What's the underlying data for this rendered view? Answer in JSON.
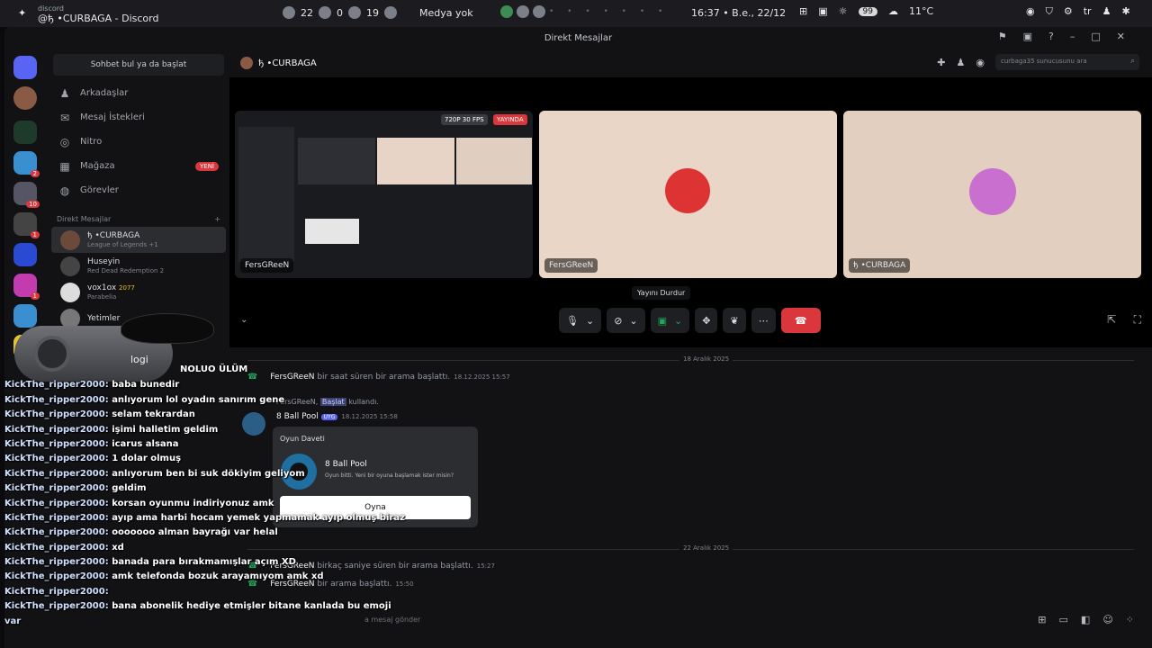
{
  "os": {
    "window_small": "discord",
    "window_title": "@ђ •CURBAGA - Discord",
    "stat_1": "22",
    "stat_2": "0",
    "stat_3": "19",
    "media": "Medya yok",
    "clock": "16:37 • B.e., 22/12",
    "badge": "99",
    "weather": "11°C",
    "lang": "tr"
  },
  "titlebar": {
    "title": "Direkt Mesajlar"
  },
  "guild_pings": [
    "2",
    "10",
    "1",
    "1"
  ],
  "dm_sidebar": {
    "find_label": "Sohbet bul ya da başlat",
    "nav": [
      {
        "label": "Arkadaşlar"
      },
      {
        "label": "Mesaj İstekleri"
      },
      {
        "label": "Nitro"
      },
      {
        "label": "Mağaza",
        "badge": "YENİ"
      },
      {
        "label": "Görevler"
      }
    ],
    "dm_header": "Direkt Mesajlar",
    "dms": [
      {
        "name": "ђ •CURBAGA",
        "sub": "League of Legends +1"
      },
      {
        "name": "Huseyin",
        "sub": "Red Dead Redemption 2"
      },
      {
        "name": "vox1ox",
        "tag": "2077",
        "sub": "Parabelia"
      },
      {
        "name": "Yetimler",
        "sub": ""
      }
    ]
  },
  "header": {
    "channel": "ђ •CURBAGA",
    "search_placeholder": "curbaga35 sunucusunu ara"
  },
  "call": {
    "tiles": [
      {
        "label": "FersGReeN",
        "badge_quality": "720P 30 FPS",
        "badge_live": "YAYINDA"
      },
      {
        "label": "FersGReeN"
      },
      {
        "label": "ђ •CURBAGA"
      }
    ],
    "tooltip": "Yayını Durdur"
  },
  "chat": {
    "date_1": "18 Aralık 2025",
    "call_1": {
      "user": "FersGReeN",
      "text": "bir saat süren bir arama başlattı.",
      "time": "18.12.2025 15:57"
    },
    "activity": {
      "user": "FersGReeN",
      "action": "Başlat",
      "suffix": "kullandı."
    },
    "bot": {
      "name": "8 Ball Pool",
      "tag": "UYG",
      "time": "18.12.2025 15:58"
    },
    "invite": {
      "title": "Oyun Daveti",
      "game": "8 Ball Pool",
      "desc": "Oyun bitti. Yeni bir oyuna başlamak ister misin?",
      "button": "Oyna"
    },
    "date_2": "22 Aralık 2025",
    "call_2": {
      "user": "FersGReeN",
      "text": "birkaç saniye süren bir arama başlattı.",
      "time": "15:27"
    },
    "call_3": {
      "user": "FersGReeN",
      "text": "bir arama başlattı.",
      "time": "15:50"
    },
    "input_placeholder": "a mesaj gönder"
  },
  "overlay": {
    "cam_logo": "logi",
    "noluo": "NOLUO ÜLÜM",
    "lines": [
      {
        "user": "",
        "text": ""
      },
      {
        "user": "KickThe_ripper2000:",
        "text": "baba bunedir"
      },
      {
        "user": "KickThe_ripper2000:",
        "text": "anlıyorum lol oyadın sanırım gene"
      },
      {
        "user": "KickThe_ripper2000:",
        "text": "selam tekrardan"
      },
      {
        "user": "KickThe_ripper2000:",
        "text": "işimi halletim geldim"
      },
      {
        "user": "KickThe_ripper2000:",
        "text": "icarus alsana"
      },
      {
        "user": "KickThe_ripper2000:",
        "text": "1 dolar olmuş"
      },
      {
        "user": "KickThe_ripper2000:",
        "text": "anlıyorum ben bi suk dökiyim geliyom"
      },
      {
        "user": "KickThe_ripper2000:",
        "text": "geldim"
      },
      {
        "user": "KickThe_ripper2000:",
        "text": "korsan oyunmu indiriyonuz amk"
      },
      {
        "user": "KickThe_ripper2000:",
        "text": "ayıp ama harbi hocam yemek yapmamak ayıp olmuş biraz"
      },
      {
        "user": "KickThe_ripper2000:",
        "text": "ooooooo alman bayrağı var helal"
      },
      {
        "user": "KickThe_ripper2000:",
        "text": "xd"
      },
      {
        "user": "KickThe_ripper2000:",
        "text": "banada para bırakmamışlar açım XD"
      },
      {
        "user": "KickThe_ripper2000:",
        "text": "amk telefonda bozuk arayamıyom amk xd"
      },
      {
        "user": "KickThe_ripper2000:",
        "text": ""
      },
      {
        "user": "KickThe_ripper2000:",
        "text": "bana abonelik hediye etmişler bitane kanlada bu emoji"
      },
      {
        "user": "var",
        "text": ""
      }
    ]
  }
}
